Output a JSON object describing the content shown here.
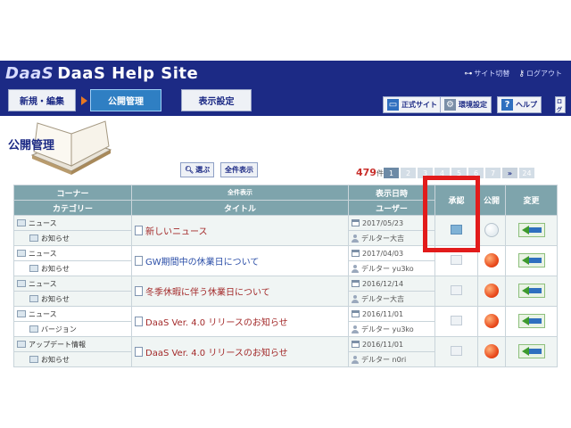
{
  "header": {
    "logo_mark": "DaaS",
    "site_title": "DaaS Help Site",
    "sitemap_link": "サイト切替",
    "logout_link": "ログアウト",
    "sitemap_icon": "sitemap-icon",
    "logout_icon": "key-icon"
  },
  "nav": {
    "tabs": [
      {
        "label": "新規・編集",
        "active": false
      },
      {
        "label": "公開管理",
        "active": true
      },
      {
        "label": "表示設定",
        "active": false
      }
    ]
  },
  "toolbar": {
    "official_site": "正式サイト",
    "environment": "環境設定",
    "help": "ヘルプ",
    "extra": "ログ"
  },
  "page": {
    "title": "公開管理",
    "select_button": "選ぶ",
    "show_all_button": "全件表示",
    "total_count": "479",
    "count_unit": "件",
    "pages": [
      "1",
      "2",
      "3",
      "4",
      "5",
      "6",
      "7",
      "»",
      "24"
    ]
  },
  "table": {
    "headers": {
      "corner": "コーナー",
      "category": "カテゴリー",
      "show_all": "全件表示",
      "title": "タイトル",
      "display_date": "表示日時",
      "user": "ユーザー",
      "approve": "承認",
      "publish": "公開",
      "change": "変更"
    },
    "rows": [
      {
        "corner": "ニュース",
        "category": "お知らせ",
        "title": "新しいニュース",
        "date": "2017/05/23",
        "user": "デルター大吉",
        "approved": true,
        "published": false,
        "title_color": "red"
      },
      {
        "corner": "ニュース",
        "category": "お知らせ",
        "title": "GW期間中の休業日について",
        "date": "2017/04/03",
        "user": "デルター yu3ko",
        "approved": false,
        "published": true,
        "title_color": "blue"
      },
      {
        "corner": "ニュース",
        "category": "お知らせ",
        "title": "冬季休暇に伴う休業日について",
        "date": "2016/12/14",
        "user": "デルター大吉",
        "approved": false,
        "published": true,
        "title_color": "red"
      },
      {
        "corner": "ニュース",
        "category": "バージョン",
        "title": "DaaS Ver. 4.0 リリースのお知らせ",
        "date": "2016/11/01",
        "user": "デルター yu3ko",
        "approved": false,
        "published": true,
        "title_color": "red"
      },
      {
        "corner": "アップデート情報",
        "category": "お知らせ",
        "title": "DaaS Ver. 4.0 リリースのお知らせ",
        "date": "2016/11/01",
        "user": "デルター n0ri",
        "approved": false,
        "published": true,
        "title_color": "red"
      }
    ]
  },
  "colors": {
    "header_bg": "#1c2a85",
    "table_header_bg": "#7ea4ac",
    "highlight": "#e21b1b",
    "count": "#c9302c"
  }
}
